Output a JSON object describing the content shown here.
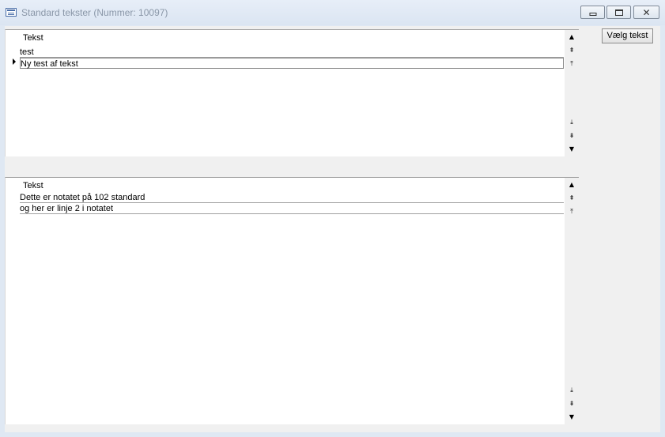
{
  "window": {
    "title": "Standard tekster (Nummer: 10097)"
  },
  "titlebar_buttons": {
    "minimize": "minimize-icon",
    "maximize": "maximize-icon",
    "close": "close-icon"
  },
  "choose_button": {
    "label": "Vælg tekst"
  },
  "top_list": {
    "header": "Tekst",
    "rows": [
      "test",
      "Ny test af tekst"
    ],
    "current_row": 1
  },
  "bottom_list": {
    "header": "Tekst",
    "rows": [
      "Dette er notatet på 102 standard",
      "og her er linje 2 i notatet"
    ]
  },
  "scrollbar_icons": [
    "scroll-up",
    "record-up",
    "page-up",
    "page-down",
    "record-down",
    "scroll-down"
  ]
}
